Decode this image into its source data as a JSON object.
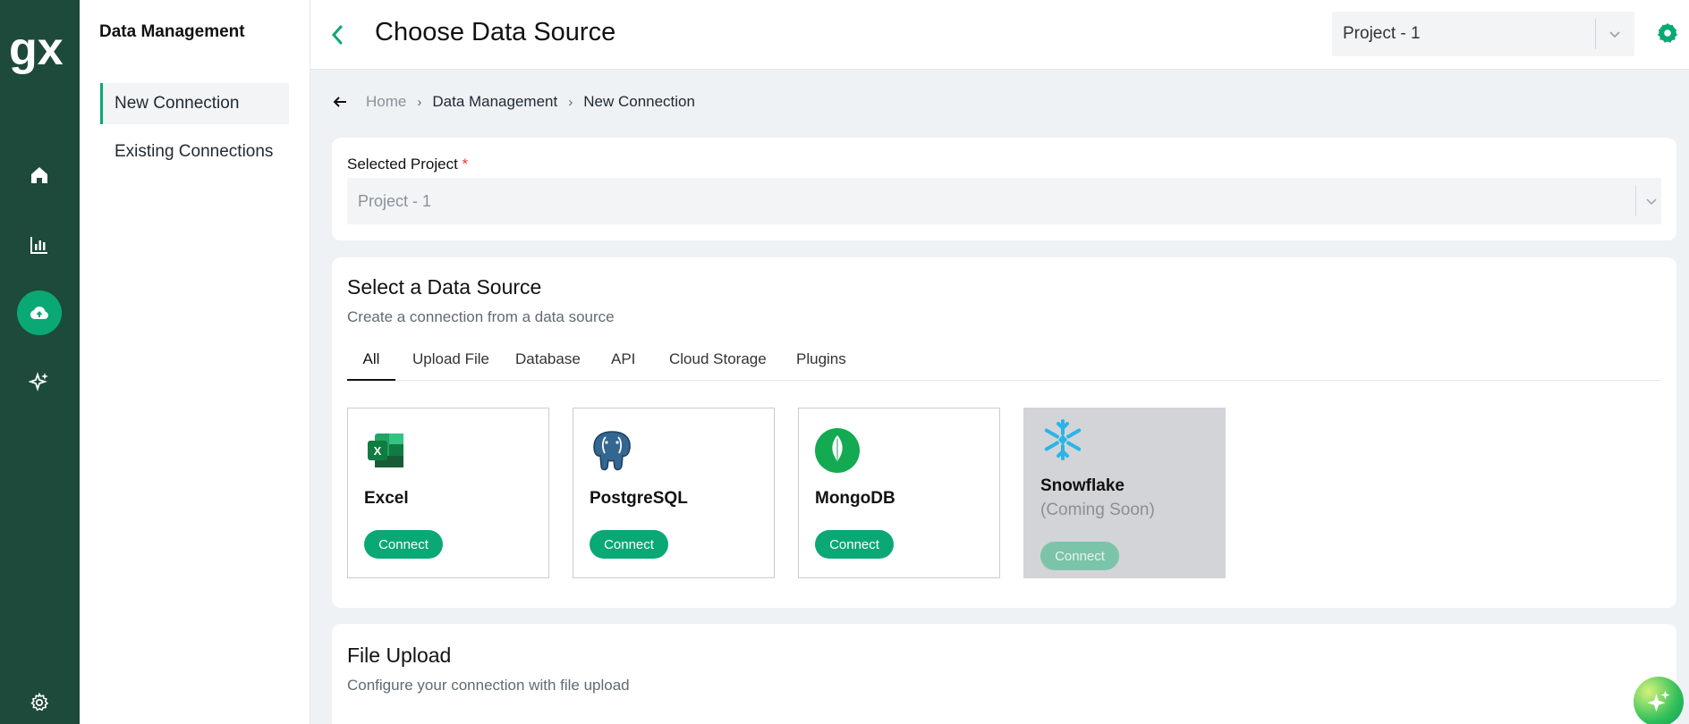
{
  "app": {
    "logo_text": "gx"
  },
  "rail": {
    "items": [
      {
        "name": "home",
        "icon": "home-icon"
      },
      {
        "name": "analytics",
        "icon": "bar-chart-icon"
      },
      {
        "name": "data",
        "icon": "cloud-upload-icon",
        "active": true
      },
      {
        "name": "ai",
        "icon": "sparkles-icon"
      },
      {
        "name": "settings",
        "icon": "gear-icon"
      }
    ]
  },
  "subnav": {
    "title": "Data Management",
    "items": [
      {
        "label": "New Connection",
        "active": true
      },
      {
        "label": "Existing Connections"
      }
    ]
  },
  "header": {
    "title": "Choose Data Source",
    "project_select": "Project - 1"
  },
  "breadcrumb": {
    "items": [
      "Home",
      "Data Management",
      "New Connection"
    ]
  },
  "project_card": {
    "label": "Selected Project",
    "required_mark": "*",
    "value": "Project - 1"
  },
  "sources_card": {
    "title": "Select a Data Source",
    "subtitle": "Create a connection from a data source",
    "tabs": [
      "All",
      "Upload File",
      "Database",
      "API",
      "Cloud Storage",
      "Plugins"
    ],
    "active_tab": "All",
    "sources": [
      {
        "name": "Excel",
        "button": "Connect",
        "icon": "excel-icon"
      },
      {
        "name": "PostgreSQL",
        "button": "Connect",
        "icon": "postgresql-icon"
      },
      {
        "name": "MongoDB",
        "button": "Connect",
        "icon": "mongodb-icon"
      },
      {
        "name": "Snowflake",
        "status": "(Coming Soon)",
        "button": "Connect",
        "icon": "snowflake-icon",
        "disabled": true
      }
    ]
  },
  "upload_card": {
    "title": "File Upload",
    "subtitle": "Configure your connection with file upload"
  },
  "colors": {
    "rail_bg": "#1d4a3a",
    "accent": "#0aa874",
    "page_bg": "#eef2f5"
  }
}
